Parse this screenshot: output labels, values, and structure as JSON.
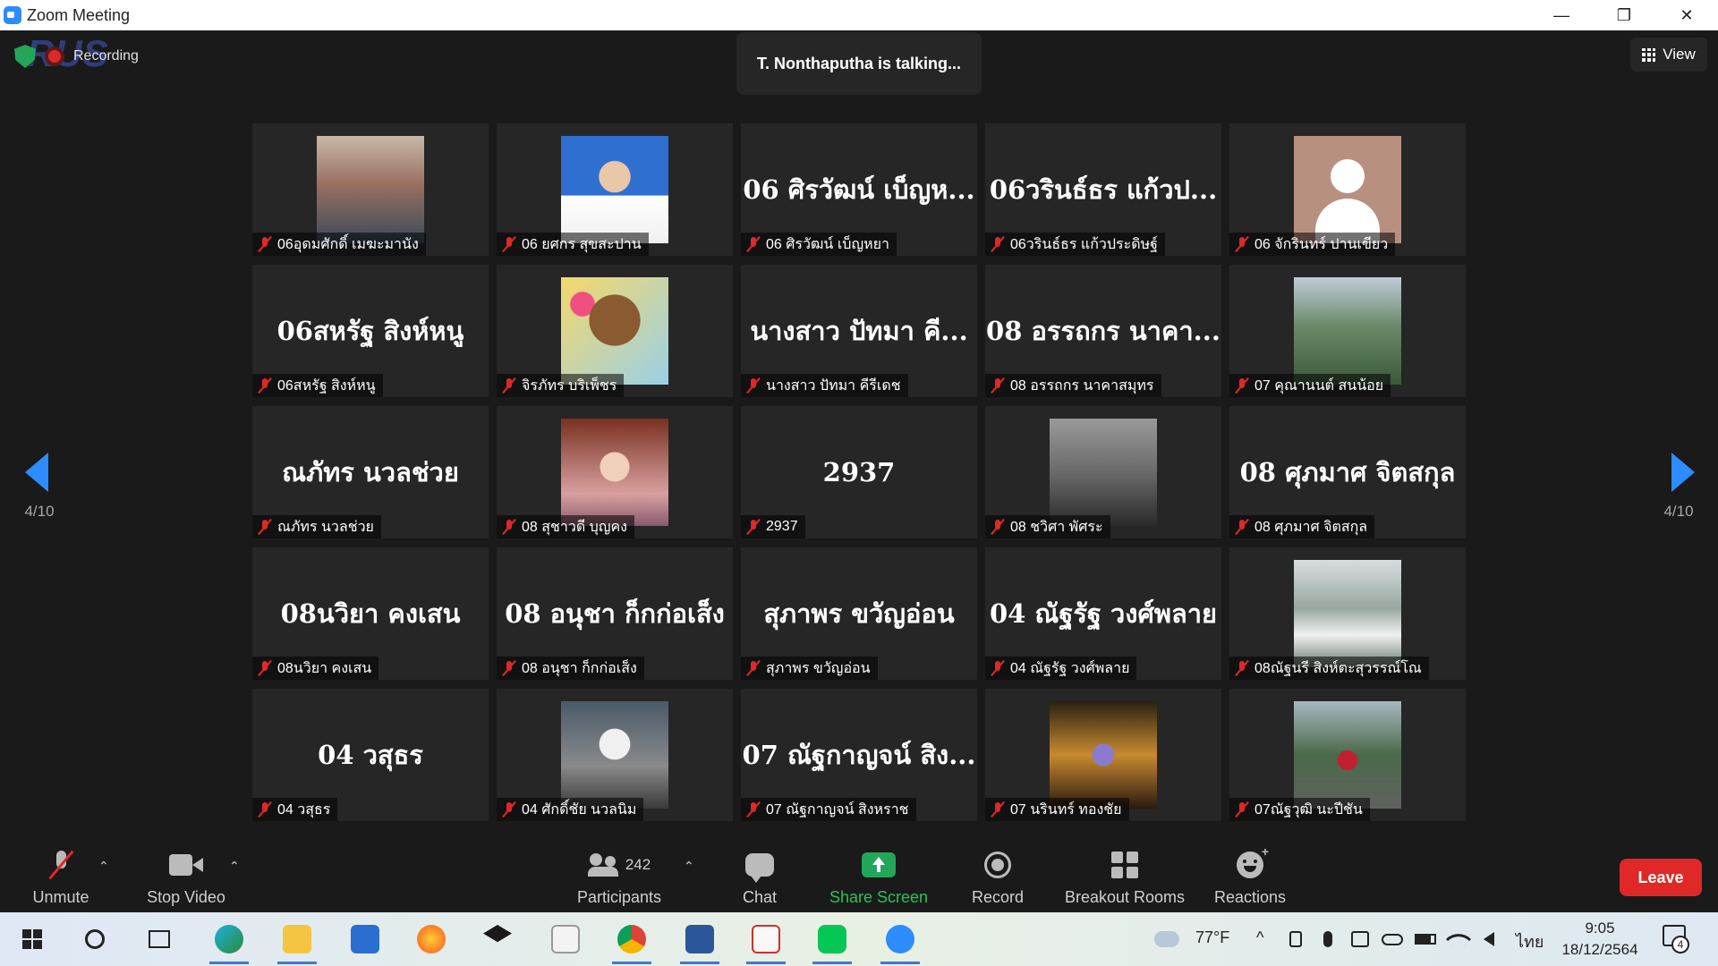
{
  "window": {
    "title": "Zoom Meeting",
    "controls": {
      "minimize": "—",
      "restore": "❐",
      "close": "✕"
    }
  },
  "meeting": {
    "recording_label": "Recording",
    "brand_overlay": "RUS",
    "talking_indicator": "T. Nonthaputha is talking...",
    "view_label": "View",
    "page_left": "4/10",
    "page_right": "4/10"
  },
  "participants": [
    {
      "tile_text": "",
      "name": "06อุดมศักดิ์ เมฆะมานัง",
      "photo": "ph-1"
    },
    {
      "tile_text": "",
      "name": "06 ยศกร สุขสะปาน",
      "photo": "ph-2"
    },
    {
      "tile_text": "06 ศิรวัฒน์ เบ็ญห...",
      "name": "06 ศิรวัฒน์ เบ็ญหยา",
      "photo": ""
    },
    {
      "tile_text": "06วรินธ์ธร แก้วป...",
      "name": "06วรินธ์ธร แก้วประดิษฐ์",
      "photo": ""
    },
    {
      "tile_text": "",
      "name": "06 จักรินทร์ ปานเขียว",
      "photo": "ph-3"
    },
    {
      "tile_text": "06สหรัฐ สิงห์หนู",
      "name": "06สหรัฐ สิงห์หนู",
      "photo": ""
    },
    {
      "tile_text": "",
      "name": "จิรภัทร บริเพ็ชร",
      "photo": "ph-4"
    },
    {
      "tile_text": "นางสาว ปัทมา คี...",
      "name": "นางสาว ปัทมา คีรีเดช",
      "photo": ""
    },
    {
      "tile_text": "08 อรรถกร นาคา...",
      "name": "08 อรรถกร นาคาสมุทร",
      "photo": ""
    },
    {
      "tile_text": "",
      "name": "07 คุณานนต์ สนน้อย",
      "photo": "ph-5"
    },
    {
      "tile_text": "ณภัทร นวลช่วย",
      "name": "ณภัทร นวลช่วย",
      "photo": ""
    },
    {
      "tile_text": "",
      "name": "08 สุชาวดี บุญคง",
      "photo": "ph-6"
    },
    {
      "tile_text": "2937",
      "name": "2937",
      "photo": ""
    },
    {
      "tile_text": "",
      "name": "08 ชวิศา พัศระ",
      "photo": "ph-7"
    },
    {
      "tile_text": "08 ศุภมาศ จิตสกุล",
      "name": "08 ศุภมาศ จิตสกุล",
      "photo": ""
    },
    {
      "tile_text": "08นวิยา คงเสน",
      "name": "08นวิยา คงเสน",
      "photo": ""
    },
    {
      "tile_text": "08 อนุชา  ก็กก่อเส็ง",
      "name": "08 อนุชา  ก็กก่อเส็ง",
      "photo": ""
    },
    {
      "tile_text": "สุภาพร ขวัญอ่อน",
      "name": "สุภาพร ขวัญอ่อน",
      "photo": ""
    },
    {
      "tile_text": "04 ณัฐรัฐ วงศ์พลาย",
      "name": "04 ณัฐรัฐ วงศ์พลาย",
      "photo": ""
    },
    {
      "tile_text": "",
      "name": "08ณัฐนรี สิงห์ตะสุวรรณ์โณ",
      "photo": "ph-8"
    },
    {
      "tile_text": "04  วสุธร",
      "name": "04  วสุธร",
      "photo": ""
    },
    {
      "tile_text": "",
      "name": "04 ศักดิ์ชัย นวลนิม",
      "photo": "ph-9"
    },
    {
      "tile_text": "07 ณัฐกาญจน์ สิง...",
      "name": "07 ณัฐกาญจน์ สิงหราช",
      "photo": ""
    },
    {
      "tile_text": "",
      "name": "07 นรินทร์ ทองชัย",
      "photo": "ph-10"
    },
    {
      "tile_text": "",
      "name": "07ณัฐวุฒิ นะปีชัน",
      "photo": "ph-11"
    }
  ],
  "toolbar": {
    "unmute": "Unmute",
    "stop_video": "Stop Video",
    "participants": "Participants",
    "participants_count": "242",
    "chat": "Chat",
    "share_screen": "Share Screen",
    "record": "Record",
    "breakout_rooms": "Breakout Rooms",
    "reactions": "Reactions",
    "leave": "Leave",
    "caret": "⌃"
  },
  "taskbar": {
    "weather": "77°F",
    "tray_caret": "^",
    "language": "ไทย",
    "time": "9:05",
    "date": "18/12/2564",
    "notification_count": "4"
  },
  "colors": {
    "accent": "#2d8cff",
    "share_green": "#23a55a",
    "leave_red": "#e02828",
    "tile_bg": "#262626"
  }
}
